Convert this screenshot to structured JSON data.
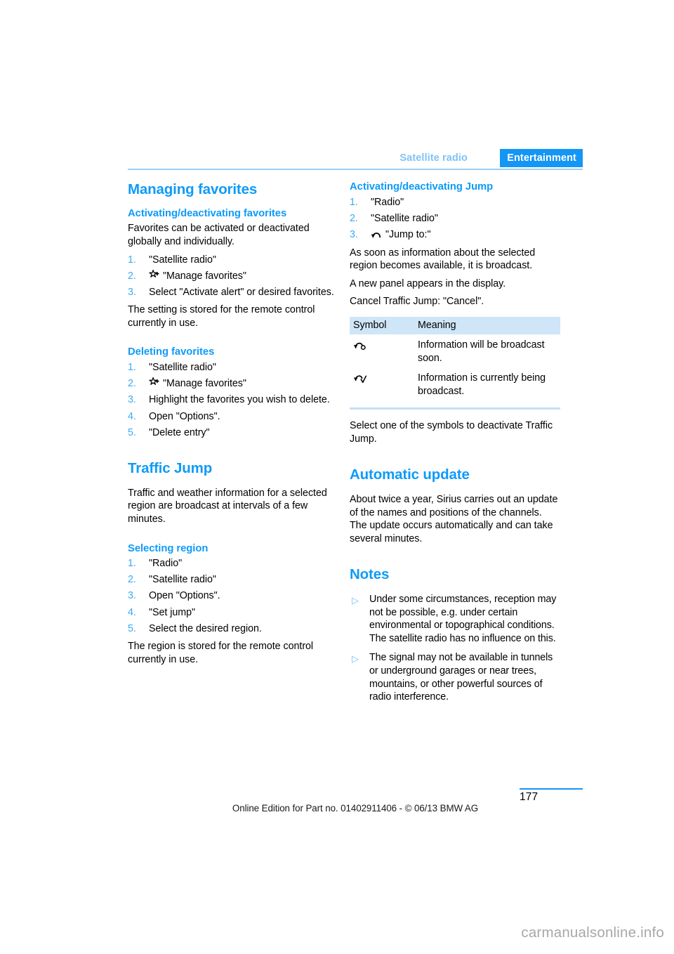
{
  "header": {
    "chapter": "Satellite radio",
    "section": "Entertainment"
  },
  "left_column": {
    "title": "Managing favorites",
    "sub1": {
      "heading": "Activating/deactivating favorites",
      "intro": "Favorites can be activated or deactivated globally and individually.",
      "steps": [
        {
          "num": "1.",
          "text": "\"Satellite radio\"",
          "icon": ""
        },
        {
          "num": "2.",
          "text": "\"Manage favorites\"",
          "icon": "star-plus-icon"
        },
        {
          "num": "3.",
          "text": "Select \"Activate alert\" or desired favorites.",
          "icon": ""
        }
      ],
      "outro": "The setting is stored for the remote control currently in use."
    },
    "sub2": {
      "heading": "Deleting favorites",
      "steps": [
        {
          "num": "1.",
          "text": "\"Satellite radio\"",
          "icon": ""
        },
        {
          "num": "2.",
          "text": "\"Manage favorites\"",
          "icon": "star-plus-icon"
        },
        {
          "num": "3.",
          "text": "Highlight the favorites you wish to delete.",
          "icon": ""
        },
        {
          "num": "4.",
          "text": "Open \"Options\".",
          "icon": ""
        },
        {
          "num": "5.",
          "text": "\"Delete entry\"",
          "icon": ""
        }
      ]
    },
    "title2": "Traffic Jump",
    "traffic_intro": "Traffic and weather information for a selected region are broadcast at intervals of a few minutes.",
    "sub3": {
      "heading": "Selecting region",
      "steps": [
        {
          "num": "1.",
          "text": "\"Radio\"",
          "icon": ""
        },
        {
          "num": "2.",
          "text": "\"Satellite radio\"",
          "icon": ""
        },
        {
          "num": "3.",
          "text": "Open \"Options\".",
          "icon": ""
        },
        {
          "num": "4.",
          "text": "\"Set jump\"",
          "icon": ""
        },
        {
          "num": "5.",
          "text": "Select the desired region.",
          "icon": ""
        }
      ],
      "outro": "The region is stored for the remote control currently in use."
    }
  },
  "right_column": {
    "sub1": {
      "heading": "Activating/deactivating Jump",
      "steps": [
        {
          "num": "1.",
          "text": "\"Radio\"",
          "icon": ""
        },
        {
          "num": "2.",
          "text": "\"Satellite radio\"",
          "icon": ""
        },
        {
          "num": "3.",
          "text": "\"Jump to:\"",
          "icon": "jump-arch-icon"
        }
      ],
      "para1": "As soon as information about the selected region becomes available, it is broadcast.",
      "para2": "A new panel appears in the display.",
      "para3": "Cancel Traffic Jump: \"Cancel\"."
    },
    "symbol_table": {
      "headers": [
        "Symbol",
        "Meaning"
      ],
      "rows": [
        {
          "icon": "jump-arch-circle-icon",
          "meaning": "Information will be broadcast soon."
        },
        {
          "icon": "jump-arch-check-icon",
          "meaning": "Information is currently being broadcast."
        }
      ]
    },
    "after_table": "Select one of the symbols to deactivate Traffic Jump.",
    "title2": "Automatic update",
    "auto_update_text": "About twice a year, Sirius carries out an update of the names and positions of the channels. The update occurs automatically and can take several minutes.",
    "title3": "Notes",
    "notes": [
      "Under some circumstances, reception may not be possible, e.g. under certain environmental or topographical conditions. The satellite radio has no influence on this.",
      "The signal may not be available in tunnels or underground garages or near trees, mountains, or other powerful sources of radio interference."
    ],
    "bullet_glyph": "▷"
  },
  "footer": {
    "edition_line": "Online Edition for Part no. 01402911406 - © 06/13 BMW AG",
    "page_number": "177",
    "watermark": "carmanualsonline.info"
  },
  "colors": {
    "accent_blue": "#0d9bf8",
    "tab_blue": "#1496f5",
    "chapter_blue": "#7fc3f7",
    "table_header_bg": "#cfe5f8",
    "rule_blue": "#9ccdf4"
  }
}
